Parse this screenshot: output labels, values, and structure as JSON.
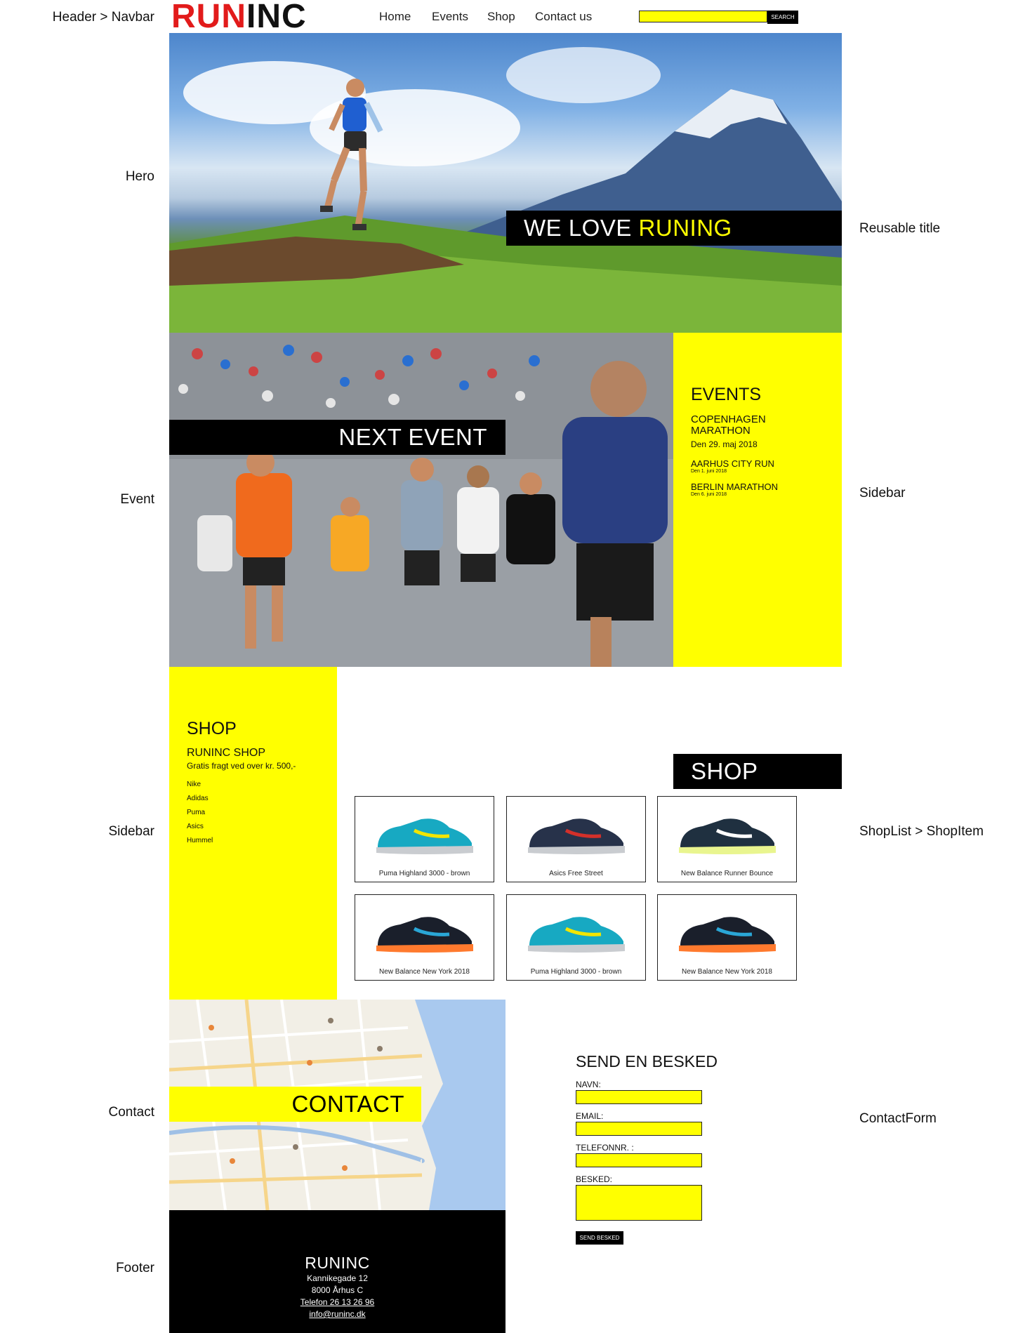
{
  "annotations": {
    "header": "Header > Navbar",
    "hero": "Hero",
    "reusable_title": "Reusable title",
    "event": "Event",
    "sidebar_right": "Sidebar",
    "sidebar_left": "Sidebar",
    "shoplist": "ShopList > ShopItem",
    "contact": "Contact",
    "contactform": "ContactForm",
    "footer": "Footer"
  },
  "header": {
    "logo_run": "RUN",
    "logo_inc": "INC",
    "nav": [
      "Home",
      "Events",
      "Shop",
      "Contact us"
    ],
    "search_button": "SEARCH"
  },
  "hero": {
    "title_white": "WE LOVE ",
    "title_yellow": "RUNING"
  },
  "event": {
    "title": "NEXT EVENT",
    "sidebar": {
      "heading": "EVENTS",
      "items": [
        {
          "name": "COPENHAGEN MARATHON",
          "date": "Den 29. maj 2018"
        },
        {
          "name": "AARHUS CITY RUN",
          "date": "Den 1. juni 2018"
        },
        {
          "name": "BERLIN MARATHON",
          "date": "Den 6. juni 2018"
        }
      ]
    }
  },
  "shop": {
    "title": "SHOP",
    "sidebar": {
      "heading": "SHOP",
      "subheading": "RUNINC SHOP",
      "tagline": "Gratis fragt ved over kr. 500,-",
      "brands": [
        "Nike",
        "Adidas",
        "Puma",
        "Asics",
        "Hummel"
      ]
    },
    "items": [
      {
        "name": "Puma Highland 3000 - brown",
        "shoe": "teal-shoe-icon"
      },
      {
        "name": "Asics Free Street",
        "shoe": "navy-shoe-icon"
      },
      {
        "name": "New Balance Runner Bounce",
        "shoe": "lime-shoe-icon"
      },
      {
        "name": "New Balance New York 2018",
        "shoe": "black-orange-shoe-icon"
      },
      {
        "name": "Puma Highland 3000 - brown",
        "shoe": "teal-shoe-icon"
      },
      {
        "name": "New Balance New York 2018",
        "shoe": "black-orange-shoe-icon"
      }
    ]
  },
  "contact": {
    "title": "CONTACT",
    "form": {
      "heading": "SEND EN BESKED",
      "name_label": "NAVN:",
      "email_label": "EMAIL:",
      "phone_label": "TELEFONNR. :",
      "message_label": "BESKED:",
      "submit": "SEND BESKED"
    }
  },
  "footer": {
    "title": "RUNINC",
    "street": "Kannikegade 12",
    "city": "8000 Århus C",
    "phone": "Telefon 26 13 26 96",
    "email": "info@runinc.dk"
  },
  "colors": {
    "accent_yellow": "#ffff00",
    "logo_red": "#e21b1b",
    "black": "#000000"
  }
}
